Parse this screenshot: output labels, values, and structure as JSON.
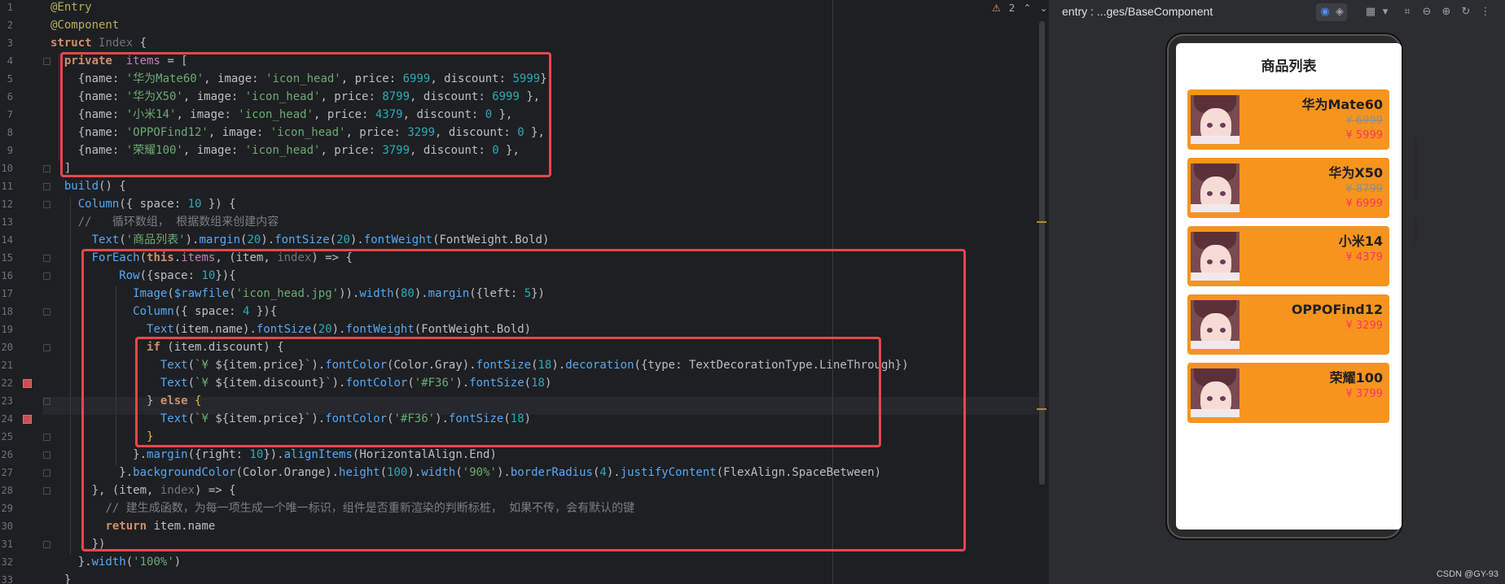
{
  "editor": {
    "inspection": {
      "warning_count": "2"
    },
    "lines": [
      {
        "n": "1",
        "html": "<span class='a'>@Entry</span>"
      },
      {
        "n": "2",
        "html": "<span class='a'>@Component</span>"
      },
      {
        "n": "3",
        "html": "<span class='kw'>struct</span> <span class='g'>Index</span> {"
      },
      {
        "n": "4",
        "html": "  <span class='kw'>private</span>  <span class='p'>items</span> = ["
      },
      {
        "n": "5",
        "html": "    {name: <span class='s'>'华为Mate60'</span>, image: <span class='s'>'icon_head'</span>, price: <span class='n'>6999</span>, discount: <span class='n'>5999</span>},"
      },
      {
        "n": "6",
        "html": "    {name: <span class='s'>'华为X50'</span>, image: <span class='s'>'icon_head'</span>, price: <span class='n'>8799</span>, discount: <span class='n'>6999</span> },"
      },
      {
        "n": "7",
        "html": "    {name: <span class='s'>'小米14'</span>, image: <span class='s'>'icon_head'</span>, price: <span class='n'>4379</span>, discount: <span class='n'>0</span> },"
      },
      {
        "n": "8",
        "html": "    {name: <span class='s'>'OPPOFind12'</span>, image: <span class='s'>'icon_head'</span>, price: <span class='n'>3299</span>, discount: <span class='n'>0</span> },"
      },
      {
        "n": "9",
        "html": "    {name: <span class='s'>'荣耀100'</span>, image: <span class='s'>'icon_head'</span>, price: <span class='n'>3799</span>, discount: <span class='n'>0</span> },"
      },
      {
        "n": "10",
        "html": "  ]"
      },
      {
        "n": "11",
        "html": "  <span class='f'>build</span>() {"
      },
      {
        "n": "12",
        "html": "    <span class='f'>Column</span>({ space: <span class='n'>10</span> }) {"
      },
      {
        "n": "13",
        "html": "    <span class='c'>//   循环数组， 根据数组来创建内容</span>"
      },
      {
        "n": "14",
        "html": "      <span class='f'>Text</span>(<span class='s'>'商品列表'</span>).<span class='f'>margin</span>(<span class='n'>20</span>).<span class='f'>fontSize</span>(<span class='n'>20</span>).<span class='f'>fontWeight</span>(FontWeight.Bold)"
      },
      {
        "n": "15",
        "html": "      <span class='f'>ForEach</span>(<span class='kw'>this</span>.<span class='p'>items</span>, (item, <span class='g'>index</span>) => {"
      },
      {
        "n": "16",
        "html": "          <span class='f'>Row</span>({space: <span class='n'>10</span>}){"
      },
      {
        "n": "17",
        "html": "            <span class='f'>Image</span>(<span class='f'>$rawfile</span>(<span class='s'>'icon_head.jpg'</span>)).<span class='f'>width</span>(<span class='n'>80</span>).<span class='f'>margin</span>({left: <span class='n'>5</span>})"
      },
      {
        "n": "18",
        "html": "            <span class='f'>Column</span>({ space: <span class='n'>4</span> }){"
      },
      {
        "n": "19",
        "html": "              <span class='f'>Text</span>(item.name).<span class='f'>fontSize</span>(<span class='n'>20</span>).<span class='f'>fontWeight</span>(FontWeight.Bold)"
      },
      {
        "n": "20",
        "html": "              <span class='kw'>if</span> (item.discount) {"
      },
      {
        "n": "21",
        "html": "                <span class='f'>Text</span>(<span class='s'>`¥ </span>${item.price}<span class='s'>`</span>).<span class='f'>fontColor</span>(Color.Gray).<span class='f'>fontSize</span>(<span class='n'>18</span>).<span class='f'>decoration</span>({type: TextDecorationType.LineThrough})"
      },
      {
        "n": "22",
        "html": "                <span class='f'>Text</span>(<span class='s'>`¥ </span>${item.discount}<span class='s'>`</span>).<span class='f'>fontColor</span>(<span class='s'>'#F36'</span>).<span class='f'>fontSize</span>(<span class='n'>18</span>)"
      },
      {
        "n": "23",
        "html": "              } <span class='kw'>else</span> <span class='y'>{</span>"
      },
      {
        "n": "24",
        "html": "                <span class='f'>Text</span>(<span class='s'>`¥ </span>${item.price}<span class='s'>`</span>).<span class='f'>fontColor</span>(<span class='s'>'#F36'</span>).<span class='f'>fontSize</span>(<span class='n'>18</span>)"
      },
      {
        "n": "25",
        "html": "              <span class='y'>}</span>"
      },
      {
        "n": "26",
        "html": "            }.<span class='f'>margin</span>({right: <span class='n'>10</span>}).<span class='f'>alignItems</span>(HorizontalAlign.End)"
      },
      {
        "n": "27",
        "html": "          }.<span class='f'>backgroundColor</span>(Color.Orange).<span class='f'>height</span>(<span class='n'>100</span>).<span class='f'>width</span>(<span class='s'>'90%'</span>).<span class='f'>borderRadius</span>(<span class='n'>4</span>).<span class='f'>justifyContent</span>(FlexAlign.SpaceBetween)"
      },
      {
        "n": "28",
        "html": "      }, (item, <span class='g'>index</span>) => {"
      },
      {
        "n": "29",
        "html": "        <span class='c'>// 建生成函数，为每一项生成一个唯一标识，组件是否重新渲染的判断标桩， 如果不传，会有默认的键</span>"
      },
      {
        "n": "30",
        "html": "        <span class='kw'>return</span> item.name"
      },
      {
        "n": "31",
        "html": "      })"
      },
      {
        "n": "32",
        "html": "    }.<span class='f'>width</span>(<span class='s'>'100%'</span>)"
      },
      {
        "n": "33",
        "html": "  }"
      }
    ]
  },
  "preview": {
    "title": "entry : ...ges/BaseComponent",
    "screen_title": "商品列表",
    "products": [
      {
        "name": "华为Mate60",
        "price": "¥ 6999",
        "discount": "¥ 5999"
      },
      {
        "name": "华为X50",
        "price": "¥ 8799",
        "discount": "¥ 6999"
      },
      {
        "name": "小米14",
        "price": "",
        "discount": "¥ 4379"
      },
      {
        "name": "OPPOFind12",
        "price": "",
        "discount": "¥ 3299"
      },
      {
        "name": "荣耀100",
        "price": "",
        "discount": "¥ 3799"
      }
    ],
    "colors": {
      "card": "#f7941d",
      "discount": "#ff3366",
      "highlight_box": "#e5484d"
    }
  },
  "watermark": "CSDN @GY-93"
}
